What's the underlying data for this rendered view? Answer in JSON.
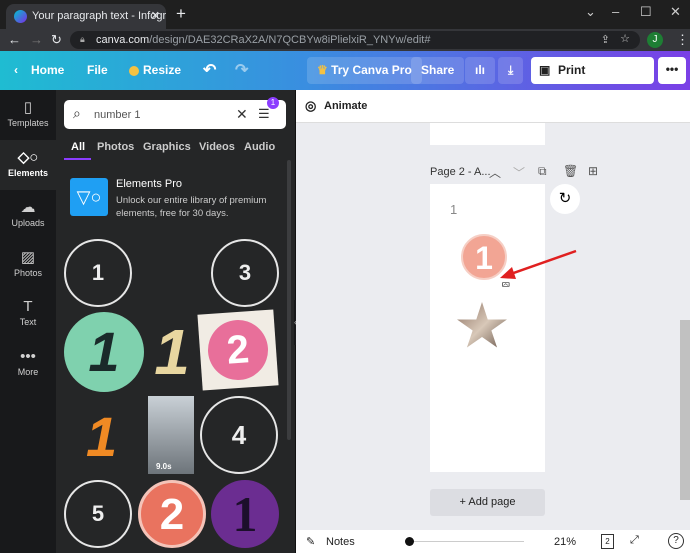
{
  "browser": {
    "tab_title": "Your paragraph text - Infographics",
    "url_host": "canva.com",
    "url_path": "/design/DAE32CRaX2A/N7QCBYw8iPlielxiR_YNYw/edit#",
    "profile": "J"
  },
  "toolbar": {
    "home": "Home",
    "file": "File",
    "resize": "Resize",
    "try_pro": "Try Canva Pro",
    "share": "Share",
    "print": "Print Infographics",
    "more": "•••"
  },
  "rail": [
    {
      "label": "Templates",
      "icon": "▯"
    },
    {
      "label": "Elements",
      "icon": "◇○"
    },
    {
      "label": "Uploads",
      "icon": "☁"
    },
    {
      "label": "Photos",
      "icon": "▨"
    },
    {
      "label": "Text",
      "icon": "T"
    },
    {
      "label": "More",
      "icon": "•••"
    }
  ],
  "search": {
    "value": "number 1",
    "filter_badge": "1"
  },
  "panel_tabs": [
    "All",
    "Photos",
    "Graphics",
    "Videos",
    "Audio"
  ],
  "promo": {
    "title": "Elements Pro",
    "desc": "Unlock our entire library of premium elements, free for 30 days."
  },
  "results": {
    "t1": "1",
    "t3": "3",
    "t_green": "1",
    "t_gold": "1",
    "t_pink": "2",
    "t_orange": "1",
    "video_duration": "9.0s",
    "t4": "4",
    "t5": "5",
    "t_red": "2",
    "t_purple": "1"
  },
  "editor": {
    "animate": "Animate",
    "page_label": "Page 2 - A...",
    "page_text": "1",
    "sticker": "1",
    "add_page": "+ Add page"
  },
  "bottom": {
    "notes": "Notes",
    "zoom": "21%",
    "page_count": "2",
    "zoom_fraction": 0.0
  },
  "colors": {
    "accent": "#8b3dff",
    "annotation_arrow": "#e02020"
  }
}
